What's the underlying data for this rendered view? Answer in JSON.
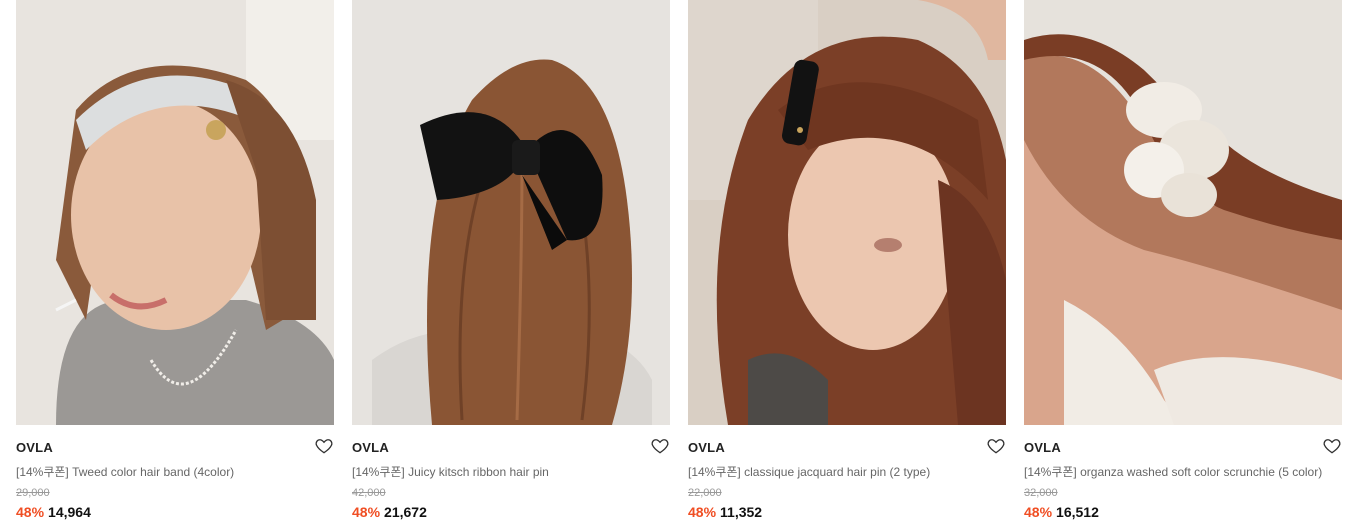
{
  "colors": {
    "discount": "#f04e23",
    "price": "#111111",
    "brand": "#222222"
  },
  "products": [
    {
      "image": "woman-tweed-hairband-photo",
      "brand": "OVLA",
      "title": "[14%쿠폰] Tweed color hair band (4color)",
      "original_price": "29,000",
      "discount": "48%",
      "price": "14,964",
      "wish_icon": "heart-outline-icon"
    },
    {
      "image": "black-ribbon-hairpin-photo",
      "brand": "OVLA",
      "title": "[14%쿠폰] Juicy kitsch ribbon hair pin",
      "original_price": "42,000",
      "discount": "48%",
      "price": "21,672",
      "wish_icon": "heart-outline-icon"
    },
    {
      "image": "woman-jacquard-hairpin-photo",
      "brand": "OVLA",
      "title": "[14%쿠폰] classique jacquard hair pin (2 type)",
      "original_price": "22,000",
      "discount": "48%",
      "price": "11,352",
      "wish_icon": "heart-outline-icon"
    },
    {
      "image": "organza-scrunchie-photo",
      "brand": "OVLA",
      "title": "[14%쿠폰] organza washed soft color scrunchie (5 color)",
      "original_price": "32,000",
      "discount": "48%",
      "price": "16,512",
      "wish_icon": "heart-outline-icon"
    }
  ]
}
